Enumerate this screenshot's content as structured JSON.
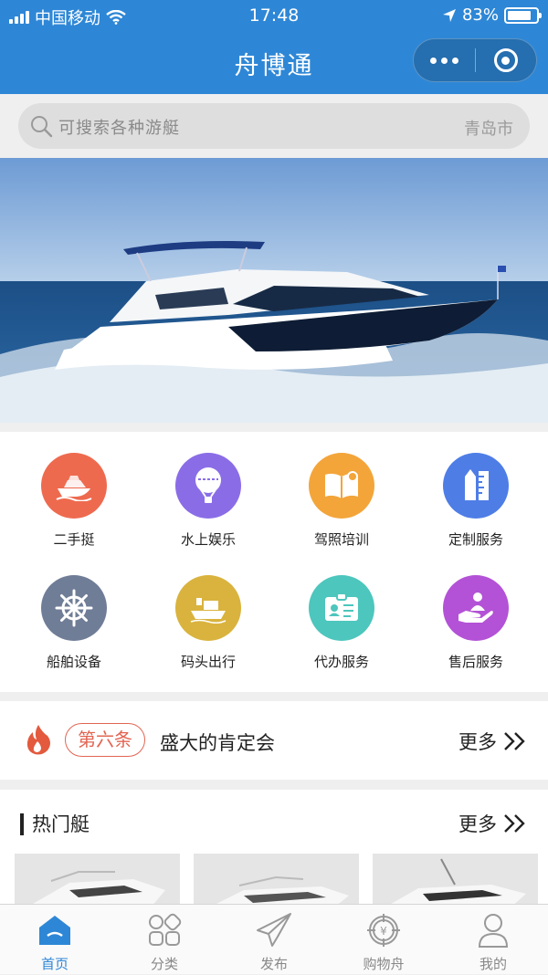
{
  "status_bar": {
    "carrier": "中国移动",
    "time": "17:48",
    "battery": "83%",
    "battery_level": 0.83
  },
  "navbar": {
    "title": "舟博通"
  },
  "search": {
    "placeholder": "可搜索各种游艇",
    "city": "青岛市"
  },
  "banner": {
    "image": "yacht-photo",
    "slides": 1,
    "active_slide": 1
  },
  "categories": [
    {
      "label": "二手挺",
      "icon": "yacht-icon",
      "color": "#ee6a4f"
    },
    {
      "label": "水上娱乐",
      "icon": "hot-air-balloon-icon",
      "color": "#8a6de6"
    },
    {
      "label": "驾照培训",
      "icon": "book-icon",
      "color": "#f3a53a"
    },
    {
      "label": "定制服务",
      "icon": "ruler-pencil-icon",
      "color": "#4e7de6"
    },
    {
      "label": "船舶设备",
      "icon": "helm-wheel-icon",
      "color": "#707d97"
    },
    {
      "label": "码头出行",
      "icon": "cargo-ship-icon",
      "color": "#d9b33e"
    },
    {
      "label": "代办服务",
      "icon": "id-card-icon",
      "color": "#4dc6bd"
    },
    {
      "label": "售后服务",
      "icon": "hand-service-icon",
      "color": "#b352d6"
    }
  ],
  "notice": {
    "tag": "第六条",
    "text": "盛大的肯定会",
    "more": "更多"
  },
  "hot_boats": {
    "title": "热门艇",
    "more": "更多"
  },
  "tabbar": [
    {
      "label": "首页",
      "icon": "home-icon",
      "active": true
    },
    {
      "label": "分类",
      "icon": "category-icon",
      "active": false
    },
    {
      "label": "发布",
      "icon": "paper-plane-icon",
      "active": false
    },
    {
      "label": "购物舟",
      "icon": "cart-helm-icon",
      "active": false
    },
    {
      "label": "我的",
      "icon": "user-icon",
      "active": false
    }
  ],
  "colors": {
    "primary": "#2e87d6",
    "accent": "#e26552"
  }
}
